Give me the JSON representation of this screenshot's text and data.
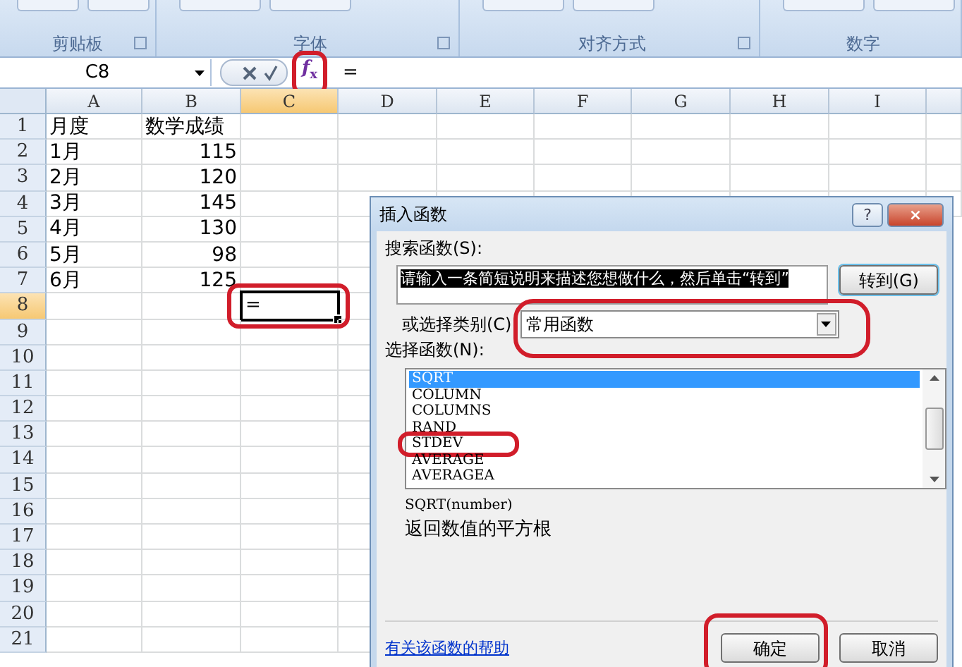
{
  "ribbon": {
    "groups": [
      {
        "label": "剪贴板",
        "launcher": true
      },
      {
        "label": "字体",
        "launcher": true
      },
      {
        "label": "对齐方式",
        "launcher": true
      },
      {
        "label": "数字",
        "launcher": false
      }
    ]
  },
  "formula_bar": {
    "name_box": "C8",
    "fx_button": "*f*$_{x}$",
    "fx_highlighted": true,
    "formula": "="
  },
  "sheet": {
    "columns": [
      {
        "label": "A",
        "selected": false
      },
      {
        "label": "B",
        "selected": false
      },
      {
        "label": "C",
        "selected": true
      },
      {
        "label": "D",
        "selected": false
      },
      {
        "label": "E",
        "selected": false
      },
      {
        "label": "F",
        "selected": false
      },
      {
        "label": "G",
        "selected": false
      },
      {
        "label": "H",
        "selected": false
      },
      {
        "label": "I",
        "selected": false
      }
    ],
    "rows": [
      {
        "number": "1",
        "selected": false,
        "cells": [
          {
            "text": "月度",
            "kind": "text"
          },
          {
            "text": "数学成绩",
            "kind": "text"
          }
        ]
      },
      {
        "number": "2",
        "selected": false,
        "cells": [
          {
            "text": "1月",
            "kind": "text"
          },
          {
            "text": "115",
            "kind": "number"
          }
        ]
      },
      {
        "number": "3",
        "selected": false,
        "cells": [
          {
            "text": "2月",
            "kind": "text"
          },
          {
            "text": "120",
            "kind": "number"
          }
        ]
      },
      {
        "number": "4",
        "selected": false,
        "cells": [
          {
            "text": "3月",
            "kind": "text"
          },
          {
            "text": "145",
            "kind": "number"
          }
        ]
      },
      {
        "number": "5",
        "selected": false,
        "cells": [
          {
            "text": "4月",
            "kind": "text"
          },
          {
            "text": "130",
            "kind": "number"
          }
        ]
      },
      {
        "number": "6",
        "selected": false,
        "cells": [
          {
            "text": "5月",
            "kind": "text"
          },
          {
            "text": "98",
            "kind": "number"
          }
        ]
      },
      {
        "number": "7",
        "selected": false,
        "cells": [
          {
            "text": "6月",
            "kind": "text"
          },
          {
            "text": "125",
            "kind": "number"
          }
        ]
      },
      {
        "number": "8",
        "selected": true,
        "editing_cell": {
          "text": "=",
          "highlighted": true
        }
      },
      {
        "number": "9",
        "selected": false
      },
      {
        "number": "10",
        "selected": false
      },
      {
        "number": "11",
        "selected": false
      },
      {
        "number": "12",
        "selected": false
      },
      {
        "number": "13",
        "selected": false
      },
      {
        "number": "14",
        "selected": false
      },
      {
        "number": "15",
        "selected": false
      },
      {
        "number": "16",
        "selected": false
      },
      {
        "number": "17",
        "selected": false
      },
      {
        "number": "18",
        "selected": false
      },
      {
        "number": "19",
        "selected": false
      },
      {
        "number": "20",
        "selected": false
      },
      {
        "number": "21",
        "selected": false
      }
    ]
  },
  "dialog": {
    "title": "插入函数",
    "help_button": "?",
    "close_button": "×",
    "search_label": "搜索函数(S):",
    "search_value": "请输入一条简短说明来描述您想做什么，然后单击“转到”",
    "go_button": "转到(G)",
    "category_label": "或选择类别(C)",
    "category_value": "常用函数",
    "category_highlighted": true,
    "function_label": "选择函数(N):",
    "functions": [
      {
        "name": "SQRT",
        "selected": true,
        "highlighted": false
      },
      {
        "name": "COLUMN",
        "selected": false,
        "highlighted": false
      },
      {
        "name": "COLUMNS",
        "selected": false,
        "highlighted": false
      },
      {
        "name": "RAND",
        "selected": false,
        "highlighted": false
      },
      {
        "name": "STDEV",
        "selected": false,
        "highlighted": true
      },
      {
        "name": "AVERAGE",
        "selected": false,
        "highlighted": false
      },
      {
        "name": "AVERAGEA",
        "selected": false,
        "highlighted": false
      }
    ],
    "signature": "SQRT(number)",
    "description": "返回数值的平方根",
    "help_link": "有关该函数的帮助",
    "buttons": [
      {
        "label": "确定",
        "highlighted": true
      },
      {
        "label": "取消",
        "highlighted": false
      }
    ]
  }
}
